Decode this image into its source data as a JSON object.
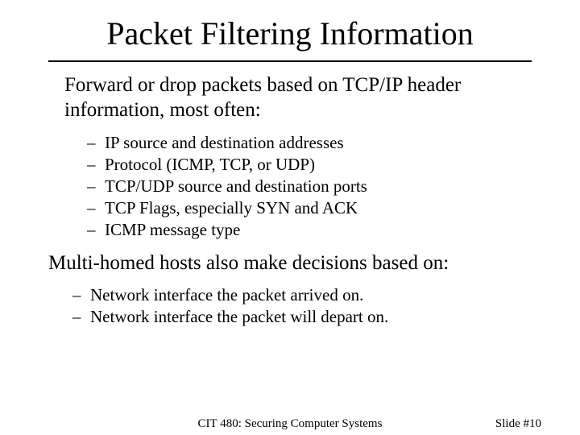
{
  "title": "Packet Filtering Information",
  "lead1": "Forward or drop packets based on TCP/IP header information, most often:",
  "list1": {
    "i0": "IP source and destination addresses",
    "i1": "Protocol (ICMP, TCP, or UDP)",
    "i2": "TCP/UDP source and destination ports",
    "i3": "TCP Flags, especially SYN and ACK",
    "i4": "ICMP message type"
  },
  "lead2": "Multi-homed hosts also make decisions based on:",
  "list2": {
    "i0": "Network interface the packet arrived on.",
    "i1": "Network interface the packet will depart on."
  },
  "footer": {
    "course": "CIT 480: Securing Computer Systems",
    "slide": "Slide #10"
  },
  "dash": "–"
}
